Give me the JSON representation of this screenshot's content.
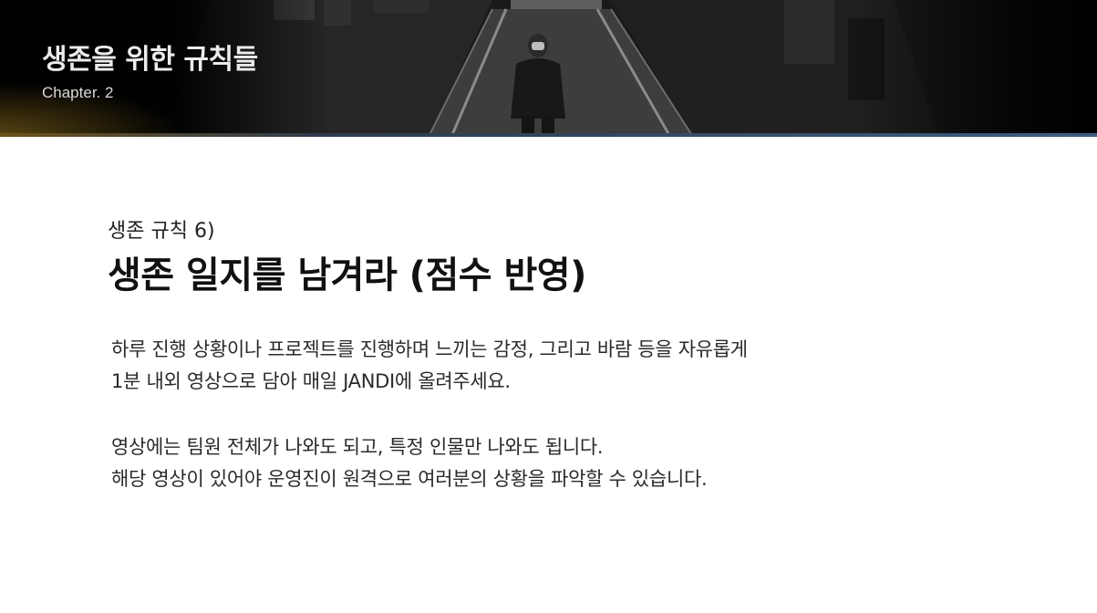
{
  "header": {
    "title": "생존을 위한 규칙들",
    "subtitle": "Chapter. 2"
  },
  "rule": {
    "label": "생존 규칙 6)",
    "heading": "생존 일지를 남겨라 (점수 반영)"
  },
  "body": {
    "paragraph1": [
      "하루 진행 상황이나 프로젝트를 진행하며 느끼는 감정, 그리고 바람 등을 자유롭게",
      "1분 내외 영상으로 담아 매일 JANDI에 올려주세요."
    ],
    "paragraph2": [
      "영상에는 팀원 전체가 나와도 되고, 특정 인물만 나와도 됩니다.",
      "해당 영상이 있어야 운영진이 원격으로 여러분의 상황을 파악할 수 있습니다."
    ]
  },
  "colors": {
    "banner_background": "#050505",
    "accent_line": "#3c5d83",
    "heading_text": "#111111",
    "body_text": "#2a2a2a"
  }
}
